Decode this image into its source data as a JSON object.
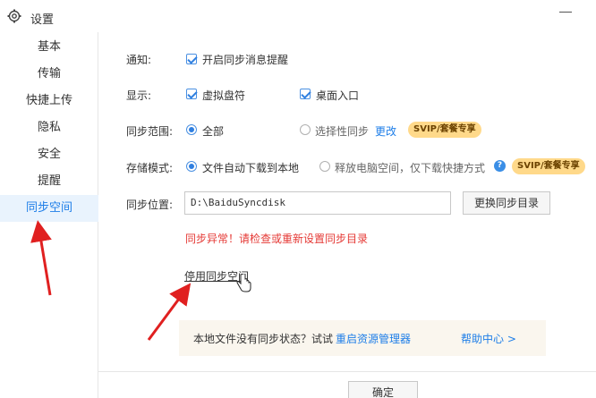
{
  "window": {
    "title": "设置"
  },
  "sidebar": {
    "items": [
      {
        "label": "基本"
      },
      {
        "label": "传输"
      },
      {
        "label": "快捷上传"
      },
      {
        "label": "隐私"
      },
      {
        "label": "安全"
      },
      {
        "label": "提醒"
      },
      {
        "label": "同步空间",
        "active": true
      }
    ]
  },
  "settings": {
    "notify": {
      "label": "通知:",
      "option": "开启同步消息提醒"
    },
    "display": {
      "label": "显示:",
      "options": [
        "虚拟盘符",
        "桌面入口"
      ]
    },
    "sync_scope": {
      "label": "同步范围:",
      "option_all": "全部",
      "option_selective": "选择性同步",
      "change_link": "更改",
      "badge": "SVIP/套餐专享"
    },
    "storage_mode": {
      "label": "存储模式:",
      "option_auto": "文件自动下载到本地",
      "option_free": "释放电脑空间，仅下载快捷方式",
      "help": "?",
      "badge": "SVIP/套餐专享"
    },
    "sync_location": {
      "label": "同步位置:",
      "path": "D:\\BaiduSyncdisk",
      "change_button": "更换同步目录"
    },
    "error_text": "同步异常！请检查或重新设置同步目录",
    "disable_link": "停用同步空间"
  },
  "info": {
    "text": "本地文件没有同步状态？试试",
    "link": "重启资源管理器",
    "help_center": "帮助中心 >"
  },
  "footer": {
    "ok_label": "确定"
  },
  "colors": {
    "accent": "#1e7ee8",
    "error": "#e53935",
    "badge": "#ffd98a",
    "arrow": "#e02020"
  }
}
